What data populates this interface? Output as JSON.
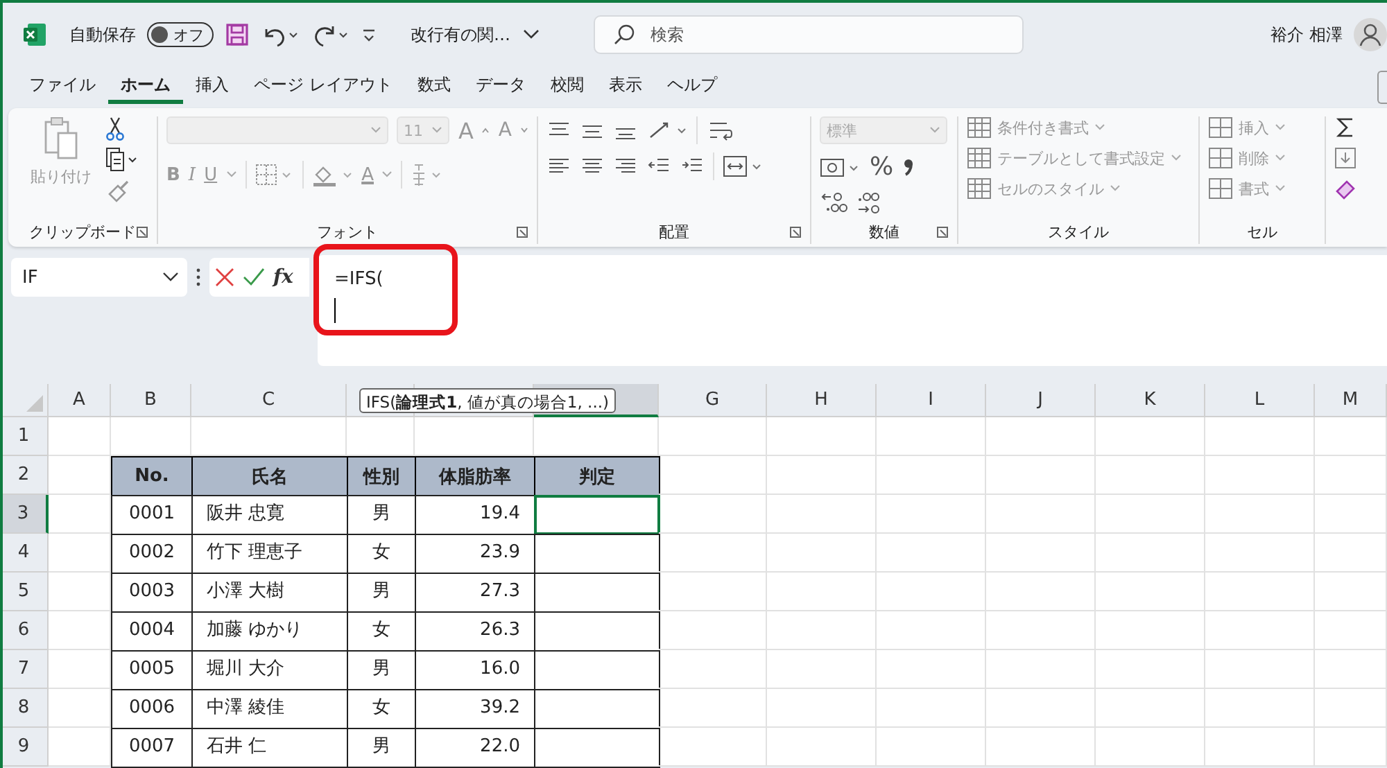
{
  "title_bar": {
    "autosave_label": "自動保存",
    "autosave": {
      "label": "オフ",
      "on": false
    },
    "document_title": "改行有の関…",
    "search": {
      "placeholder": "検索"
    },
    "user_name": "裕介 相澤"
  },
  "tabs": [
    {
      "label": "ファイル",
      "selected": false
    },
    {
      "label": "ホーム",
      "selected": true
    },
    {
      "label": "挿入",
      "selected": false
    },
    {
      "label": "ページ レイアウト",
      "selected": false
    },
    {
      "label": "数式",
      "selected": false
    },
    {
      "label": "データ",
      "selected": false
    },
    {
      "label": "校閲",
      "selected": false
    },
    {
      "label": "表示",
      "selected": false
    },
    {
      "label": "ヘルプ",
      "selected": false
    }
  ],
  "ribbon": {
    "disabled": true,
    "clipboard": {
      "label": "クリップボード",
      "paste": "貼り付け"
    },
    "font": {
      "label": "フォント",
      "size": "11",
      "grow": "A",
      "shrink": "A",
      "bold": "B",
      "italic": "I",
      "underline": "U",
      "color_letter": "A"
    },
    "alignment": {
      "label": "配置"
    },
    "number": {
      "label": "数値",
      "format": "標準",
      "percent": "%"
    },
    "styles": {
      "label": "スタイル",
      "items": [
        "条件付き書式",
        "テーブルとして書式設定",
        "セルのスタイル"
      ]
    },
    "cells": {
      "label": "セル",
      "items": [
        "挿入",
        "削除",
        "書式"
      ]
    }
  },
  "formula_bar": {
    "name_box": "IF",
    "fx": "fx",
    "formula": "=IFS(",
    "tooltip": "IFS(**論理式1**, 値が真の場合1, ...)"
  },
  "sheet": {
    "columns": [
      "A",
      "B",
      "C",
      null,
      null,
      null,
      "G",
      "H",
      "I",
      "J",
      "K",
      "L",
      "M"
    ],
    "rows": [
      "1",
      "2",
      "3",
      "4",
      "5",
      "6",
      "7",
      "8",
      "9"
    ],
    "table": {
      "columns": [
        "No.",
        "氏名",
        "性別",
        "体脂肪率",
        "判定"
      ],
      "rows": [
        {
          "cells": [
            "0001",
            "阪井 忠寛",
            "男",
            "19.4"
          ],
          "selected": true
        },
        {
          "cells": [
            "0002",
            "竹下 理恵子",
            "女",
            "23.9"
          ],
          "selected": false
        },
        {
          "cells": [
            "0003",
            "小澤 大樹",
            "男",
            "27.3"
          ],
          "selected": false
        },
        {
          "cells": [
            "0004",
            "加藤 ゆかり",
            "女",
            "26.3"
          ],
          "selected": false
        },
        {
          "cells": [
            "0005",
            "堀川 大介",
            "男",
            "16.0"
          ],
          "selected": false
        },
        {
          "cells": [
            "0006",
            "中澤 綾佳",
            "女",
            "39.2"
          ],
          "selected": false
        },
        {
          "cells": [
            "0007",
            "石井 仁",
            "男",
            "22.0"
          ],
          "selected": false
        }
      ]
    }
  }
}
